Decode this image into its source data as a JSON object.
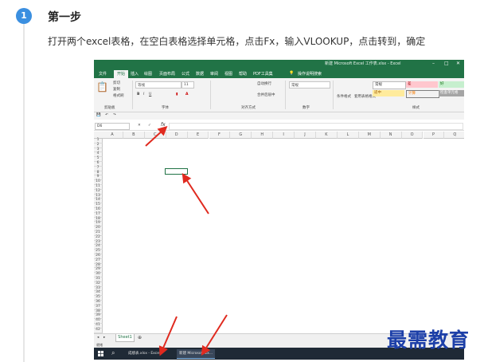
{
  "step": {
    "number": "1",
    "title": "第一步",
    "description": "打开两个excel表格，在空白表格选择单元格，点击Fx，输入VLOOKUP，点击转到，确定"
  },
  "excel": {
    "window_title": "新建 Microsoft Excel 工作表.xlsx - Excel",
    "ribbon_tabs": [
      "文件",
      "开始",
      "插入",
      "绘图",
      "页面布局",
      "公式",
      "数据",
      "审阅",
      "视图",
      "帮助",
      "PDF工具集"
    ],
    "tell_me": "操作说明搜索",
    "clipboard": {
      "cut": "剪切",
      "copy": "复制",
      "painter": "格式刷",
      "group": "剪贴板"
    },
    "font": {
      "name": "等线",
      "size": "11",
      "group": "字体"
    },
    "alignment": {
      "wrap": "自动换行",
      "merge": "合并后居中",
      "group": "对齐方式"
    },
    "number": {
      "format": "常规",
      "group": "数字"
    },
    "styles": {
      "conditional": "条件格式",
      "table": "套用表格格式",
      "normal": "常规",
      "bad": "差",
      "good": "好",
      "neutral": "适中",
      "calc": "计算",
      "check": "检查单元格",
      "group": "样式"
    },
    "name_box": "D6",
    "fx_label": "fx",
    "columns": [
      "A",
      "B",
      "C",
      "D",
      "E",
      "F",
      "G",
      "H",
      "I",
      "J",
      "K",
      "L",
      "M",
      "N",
      "O",
      "P",
      "Q"
    ],
    "rows": [
      "1",
      "2",
      "3",
      "4",
      "5",
      "6",
      "7",
      "8",
      "9",
      "10",
      "11",
      "12",
      "13",
      "14",
      "15",
      "16",
      "17",
      "18",
      "19",
      "20",
      "21",
      "22",
      "23",
      "24",
      "25",
      "26",
      "27",
      "28",
      "29",
      "30",
      "31",
      "32",
      "33",
      "34",
      "35",
      "36",
      "37",
      "38",
      "39",
      "40",
      "41",
      "42"
    ],
    "sheet_tab": "Sheet1",
    "status": "就绪",
    "taskbar": [
      "成绩表.xlsx - Excel",
      "新建 Microsoft Ex..."
    ]
  },
  "watermark": "最需教育",
  "colors": {
    "badge": "#3b8fe0",
    "excel_green": "#217346",
    "arrow": "#e02a1f",
    "watermark": "#1c3fa8"
  }
}
